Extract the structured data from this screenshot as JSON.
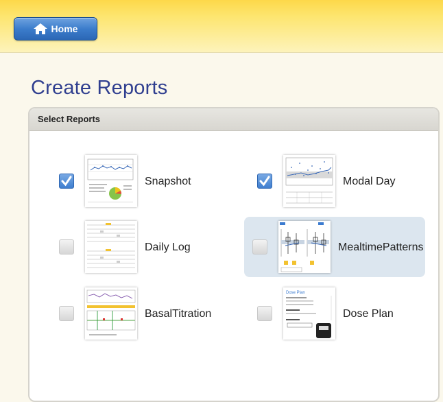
{
  "header": {
    "home_label": "Home"
  },
  "page": {
    "title": "Create Reports"
  },
  "panel": {
    "heading": "Select Reports"
  },
  "reports": [
    {
      "label": "Snapshot",
      "checked": true,
      "highlighted": false,
      "thumb_icon": "snapshot-thumbnail"
    },
    {
      "label": "Modal Day",
      "checked": true,
      "highlighted": false,
      "thumb_icon": "modal-day-thumbnail"
    },
    {
      "label": "Daily Log",
      "checked": false,
      "highlighted": false,
      "thumb_icon": "daily-log-thumbnail"
    },
    {
      "label": "Mealtime Patterns",
      "checked": false,
      "highlighted": true,
      "thumb_icon": "mealtime-patterns-thumbnail"
    },
    {
      "label": "Basal Titration",
      "checked": false,
      "highlighted": false,
      "thumb_icon": "basal-titration-thumbnail"
    },
    {
      "label": "Dose Plan",
      "checked": false,
      "highlighted": false,
      "thumb_icon": "dose-plan-thumbnail"
    }
  ],
  "thumbnail_texts": {
    "dose_plan_title": "Dose Plan"
  },
  "colors": {
    "header_gold": "#fdd84a",
    "title_blue": "#2f3e8f",
    "button_blue": "#3c7dcc",
    "selected_row": "#dce6ef"
  }
}
